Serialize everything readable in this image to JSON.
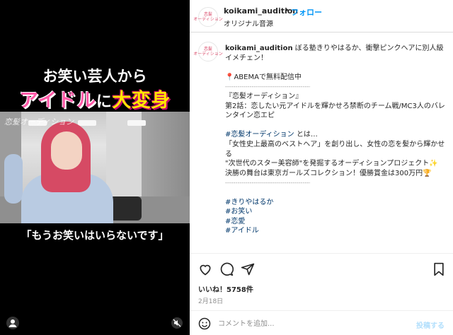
{
  "video": {
    "headline_line1": "お笑い芸人から",
    "headline_part1": "アイドル",
    "headline_part2": "に",
    "headline_part3": "大変身",
    "watermark": "恋髪オーディション",
    "quote": "「もうお笑いはいらないです」"
  },
  "header": {
    "username": "koikami_audition",
    "dot": "•",
    "follow_label": "フォロー",
    "audio_label": "オリジナル音源",
    "avatar_logo": "恋髪\nオーディション"
  },
  "caption": {
    "username": "koikami_audition",
    "intro": " ぼる塾きりやはるか、衝撃ピンクヘアに別人級イメチェン！",
    "abema": "📍ABEMAで無料配信中",
    "divider": "-----------------------------------------------",
    "title": "『恋髪オーディション』",
    "episode": "第2話：恋したい元アイドルを輝かせろ禁断のチーム戦/MC3人のバレンタイン恋エピ",
    "hashtag_inline": "#恋髪オーディション",
    "about": " とは…",
    "desc1": "「女性史上最高のベストヘア」を創り出し、女性の恋を髪から輝かせる",
    "desc2": "\"次世代のスター美容師\"を発掘するオーディションプロジェクト✨",
    "final": "決勝の舞台は東京ガールズコレクション！優勝賞金は300万円🏆",
    "hashtags": [
      "#きりやはるか",
      "#お笑い",
      "#恋愛",
      "#アイドル"
    ]
  },
  "actions": {
    "likes": "いいね！5758件",
    "date": "2月18日"
  },
  "comment": {
    "placeholder": "コメントを追加...",
    "post_label": "投稿する"
  },
  "colors": {
    "accent": "#0095f6",
    "hashtag": "#00376b",
    "pink_text": "#ff5aa8",
    "yellow_text": "#ffe600"
  }
}
